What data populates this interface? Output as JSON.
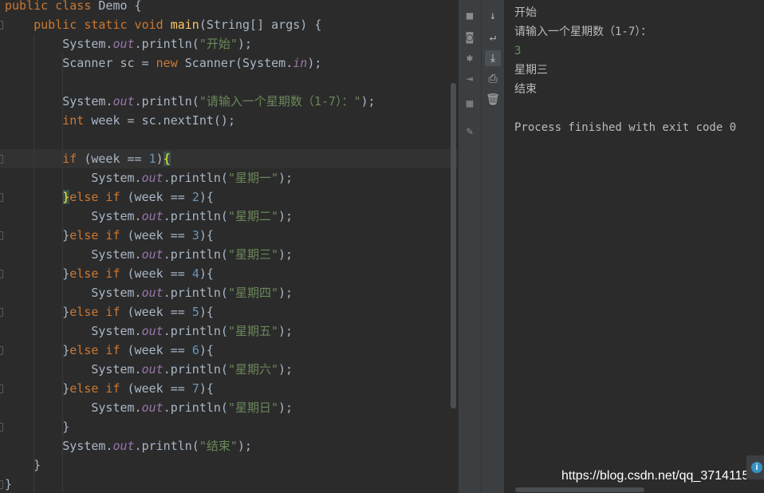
{
  "editor": {
    "lines": [
      [
        {
          "t": "public class ",
          "c": "kw"
        },
        {
          "t": "Demo {",
          "c": "p"
        }
      ],
      [
        {
          "t": "    public static void ",
          "c": "kw"
        },
        {
          "t": "main",
          "c": "fn"
        },
        {
          "t": "(String[] args) {",
          "c": "p"
        }
      ],
      [
        {
          "t": "        System.",
          "c": "p"
        },
        {
          "t": "out",
          "c": "fld"
        },
        {
          "t": ".println(",
          "c": "p"
        },
        {
          "t": "\"开始\"",
          "c": "str"
        },
        {
          "t": ");",
          "c": "p"
        }
      ],
      [
        {
          "t": "        Scanner sc = ",
          "c": "p"
        },
        {
          "t": "new ",
          "c": "kw"
        },
        {
          "t": "Scanner(System.",
          "c": "p"
        },
        {
          "t": "in",
          "c": "fld"
        },
        {
          "t": ");",
          "c": "p"
        }
      ],
      [],
      [
        {
          "t": "        System.",
          "c": "p"
        },
        {
          "t": "out",
          "c": "fld"
        },
        {
          "t": ".println(",
          "c": "p"
        },
        {
          "t": "\"请输入一个星期数（1-7）：\"",
          "c": "str"
        },
        {
          "t": ");",
          "c": "p"
        }
      ],
      [
        {
          "t": "        ",
          "c": "p"
        },
        {
          "t": "int ",
          "c": "kw"
        },
        {
          "t": "week = sc.nextInt();",
          "c": "p"
        }
      ],
      [],
      [
        {
          "t": "        ",
          "c": "p"
        },
        {
          "t": "if ",
          "c": "kw"
        },
        {
          "t": "(week == ",
          "c": "p"
        },
        {
          "t": "1",
          "c": "num"
        },
        {
          "t": ")",
          "c": "p"
        },
        {
          "t": "{",
          "c": "hl"
        }
      ],
      [
        {
          "t": "            System.",
          "c": "p"
        },
        {
          "t": "out",
          "c": "fld"
        },
        {
          "t": ".println(",
          "c": "p"
        },
        {
          "t": "\"星期一\"",
          "c": "str"
        },
        {
          "t": ");",
          "c": "p"
        }
      ],
      [
        {
          "t": "        ",
          "c": "p"
        },
        {
          "t": "}",
          "c": "hl"
        },
        {
          "t": "else if ",
          "c": "kw"
        },
        {
          "t": "(week == ",
          "c": "p"
        },
        {
          "t": "2",
          "c": "num"
        },
        {
          "t": "){",
          "c": "p"
        }
      ],
      [
        {
          "t": "            System.",
          "c": "p"
        },
        {
          "t": "out",
          "c": "fld"
        },
        {
          "t": ".println(",
          "c": "p"
        },
        {
          "t": "\"星期二\"",
          "c": "str"
        },
        {
          "t": ");",
          "c": "p"
        }
      ],
      [
        {
          "t": "        }",
          "c": "p"
        },
        {
          "t": "else if ",
          "c": "kw"
        },
        {
          "t": "(week == ",
          "c": "p"
        },
        {
          "t": "3",
          "c": "num"
        },
        {
          "t": "){",
          "c": "p"
        }
      ],
      [
        {
          "t": "            System.",
          "c": "p"
        },
        {
          "t": "out",
          "c": "fld"
        },
        {
          "t": ".println(",
          "c": "p"
        },
        {
          "t": "\"星期三\"",
          "c": "str"
        },
        {
          "t": ");",
          "c": "p"
        }
      ],
      [
        {
          "t": "        }",
          "c": "p"
        },
        {
          "t": "else if ",
          "c": "kw"
        },
        {
          "t": "(week == ",
          "c": "p"
        },
        {
          "t": "4",
          "c": "num"
        },
        {
          "t": "){",
          "c": "p"
        }
      ],
      [
        {
          "t": "            System.",
          "c": "p"
        },
        {
          "t": "out",
          "c": "fld"
        },
        {
          "t": ".println(",
          "c": "p"
        },
        {
          "t": "\"星期四\"",
          "c": "str"
        },
        {
          "t": ");",
          "c": "p"
        }
      ],
      [
        {
          "t": "        }",
          "c": "p"
        },
        {
          "t": "else if ",
          "c": "kw"
        },
        {
          "t": "(week == ",
          "c": "p"
        },
        {
          "t": "5",
          "c": "num"
        },
        {
          "t": "){",
          "c": "p"
        }
      ],
      [
        {
          "t": "            System.",
          "c": "p"
        },
        {
          "t": "out",
          "c": "fld"
        },
        {
          "t": ".println(",
          "c": "p"
        },
        {
          "t": "\"星期五\"",
          "c": "str"
        },
        {
          "t": ");",
          "c": "p"
        }
      ],
      [
        {
          "t": "        }",
          "c": "p"
        },
        {
          "t": "else if ",
          "c": "kw"
        },
        {
          "t": "(week == ",
          "c": "p"
        },
        {
          "t": "6",
          "c": "num"
        },
        {
          "t": "){",
          "c": "p"
        }
      ],
      [
        {
          "t": "            System.",
          "c": "p"
        },
        {
          "t": "out",
          "c": "fld"
        },
        {
          "t": ".println(",
          "c": "p"
        },
        {
          "t": "\"星期六\"",
          "c": "str"
        },
        {
          "t": ");",
          "c": "p"
        }
      ],
      [
        {
          "t": "        }",
          "c": "p"
        },
        {
          "t": "else if ",
          "c": "kw"
        },
        {
          "t": "(week == ",
          "c": "p"
        },
        {
          "t": "7",
          "c": "num"
        },
        {
          "t": "){",
          "c": "p"
        }
      ],
      [
        {
          "t": "            System.",
          "c": "p"
        },
        {
          "t": "out",
          "c": "fld"
        },
        {
          "t": ".println(",
          "c": "p"
        },
        {
          "t": "\"星期日\"",
          "c": "str"
        },
        {
          "t": ");",
          "c": "p"
        }
      ],
      [
        {
          "t": "        }",
          "c": "p"
        }
      ],
      [
        {
          "t": "        System.",
          "c": "p"
        },
        {
          "t": "out",
          "c": "fld"
        },
        {
          "t": ".println(",
          "c": "p"
        },
        {
          "t": "\"结束\"",
          "c": "str"
        },
        {
          "t": ");",
          "c": "p"
        }
      ],
      [
        {
          "t": "    }",
          "c": "p"
        }
      ],
      [
        {
          "t": "}",
          "c": "p"
        }
      ]
    ]
  },
  "toolbar_left": [
    "stop-icon",
    "camera-icon",
    "debug-bug-icon",
    "login-icon",
    "layout-icon",
    "pin-icon"
  ],
  "toolbar_right": [
    "down-arrow-icon",
    "soft-wrap-icon",
    "scroll-to-end-icon",
    "print-icon",
    "trash-icon"
  ],
  "console": {
    "lines": [
      {
        "text": "开始",
        "type": "out"
      },
      {
        "text": "请输入一个星期数（1-7）：",
        "type": "out"
      },
      {
        "text": "3",
        "type": "input"
      },
      {
        "text": "星期三",
        "type": "out"
      },
      {
        "text": "结束",
        "type": "out"
      },
      {
        "text": "",
        "type": "out"
      },
      {
        "text": "Process finished with exit code 0",
        "type": "out"
      }
    ]
  },
  "watermark": "https://blog.csdn.net/qq_37141156",
  "info_badge": "i",
  "colors": {
    "keyword": "#cc7832",
    "method": "#ffc66d",
    "field": "#9876aa",
    "string": "#6a8759",
    "number": "#6897bb",
    "plain": "#a9b7c6",
    "console_input": "#629755"
  }
}
